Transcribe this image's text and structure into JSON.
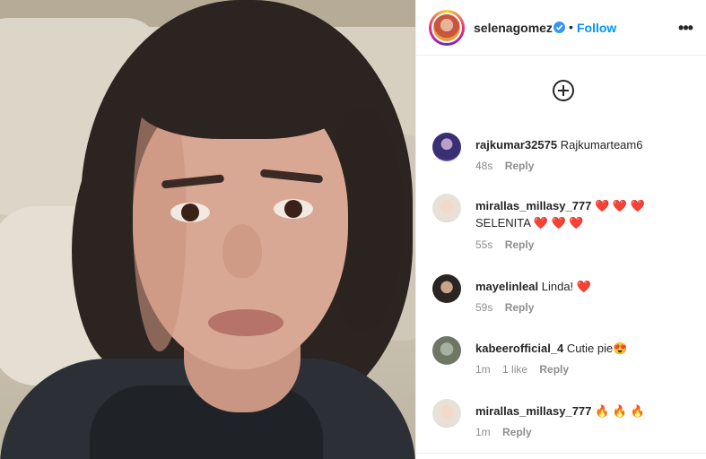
{
  "post": {
    "author": "selenagomez",
    "follow_label": "Follow",
    "separator": "•",
    "more_label": "•••",
    "verified_icon": "verified-badge-icon"
  },
  "add_button_icon": "plus-circle-icon",
  "comments": [
    {
      "user": "rajkumar32575",
      "text": "Rajkumarteam6",
      "time": "48s",
      "likes": "",
      "reply": "Reply"
    },
    {
      "user": "mirallas_millasy_777",
      "text": "❤️ ❤️ ❤️ SELENITA ❤️ ❤️ ❤️",
      "time": "55s",
      "likes": "",
      "reply": "Reply"
    },
    {
      "user": "mayelinleal",
      "text": "Linda! ❤️",
      "time": "59s",
      "likes": "",
      "reply": "Reply"
    },
    {
      "user": "kabeerofficial_4",
      "text": "Cutie pie😍",
      "time": "1m",
      "likes": "1 like",
      "reply": "Reply"
    },
    {
      "user": "mirallas_millasy_777",
      "text": "🔥 🔥 🔥",
      "time": "1m",
      "likes": "",
      "reply": "Reply"
    }
  ],
  "colors": {
    "accent": "#0095f6",
    "verified": "#3897f0",
    "heart": "#ed4956",
    "meta": "#8e8e8e"
  }
}
